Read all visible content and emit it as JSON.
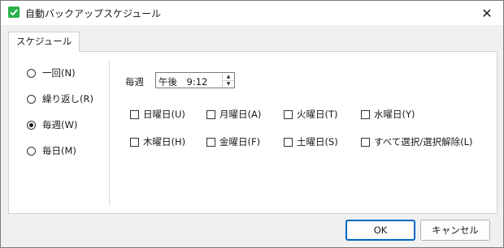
{
  "window": {
    "title": "自動バックアップスケジュール"
  },
  "tab": {
    "label": "スケジュール"
  },
  "frequency": {
    "options": [
      {
        "label": "一回(N)",
        "selected": false
      },
      {
        "label": "繰り返し(R)",
        "selected": false
      },
      {
        "label": "毎週(W)",
        "selected": true
      },
      {
        "label": "毎日(M)",
        "selected": false
      }
    ]
  },
  "schedule": {
    "label": "毎週",
    "time_value": "午後　9:12"
  },
  "days": [
    {
      "label": "日曜日(U)",
      "checked": false
    },
    {
      "label": "月曜日(A)",
      "checked": false
    },
    {
      "label": "火曜日(T)",
      "checked": false
    },
    {
      "label": "水曜日(Y)",
      "checked": false
    },
    {
      "label": "木曜日(H)",
      "checked": false
    },
    {
      "label": "金曜日(F)",
      "checked": false
    },
    {
      "label": "土曜日(S)",
      "checked": false
    },
    {
      "label": "すべて選択/選択解除(L)",
      "checked": false
    }
  ],
  "buttons": {
    "ok": "OK",
    "cancel": "キャンセル"
  },
  "colors": {
    "app_icon": "#2bb24c",
    "primary_border": "#0067c0"
  }
}
